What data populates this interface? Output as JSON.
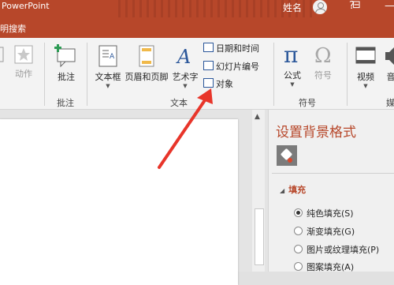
{
  "titlebar": {
    "app_title": "PowerPoint",
    "user_name": "姓名",
    "window_controls": [
      "?",
      "⊟",
      "—"
    ]
  },
  "tabs": {
    "search_hint": "明搜索"
  },
  "ribbon": {
    "star_action_label": "动作",
    "comment_label": "批注",
    "textbox_label": "文本框",
    "header_footer_label": "页眉和页脚",
    "wordart_label": "艺术字",
    "datetime_label": "日期和时间",
    "slide_number_label": "幻灯片编号",
    "object_label": "对象",
    "equation_label": "公式",
    "symbol_label": "符号",
    "video_label": "视频",
    "audio_label_partial": "音",
    "groups": {
      "left_partial": "",
      "comments": "批注",
      "text": "文本",
      "symbols": "符号",
      "media_partial": "媒"
    }
  },
  "format_pane": {
    "title": "设置背景格式",
    "section": "填充",
    "options": [
      "纯色填充(S)",
      "渐变填充(G)",
      "图片或纹理填充(P)",
      "图案填充(A)"
    ],
    "selected_index": 0
  },
  "colors": {
    "accent": "#b7472a",
    "arrow": "#e8352a"
  }
}
